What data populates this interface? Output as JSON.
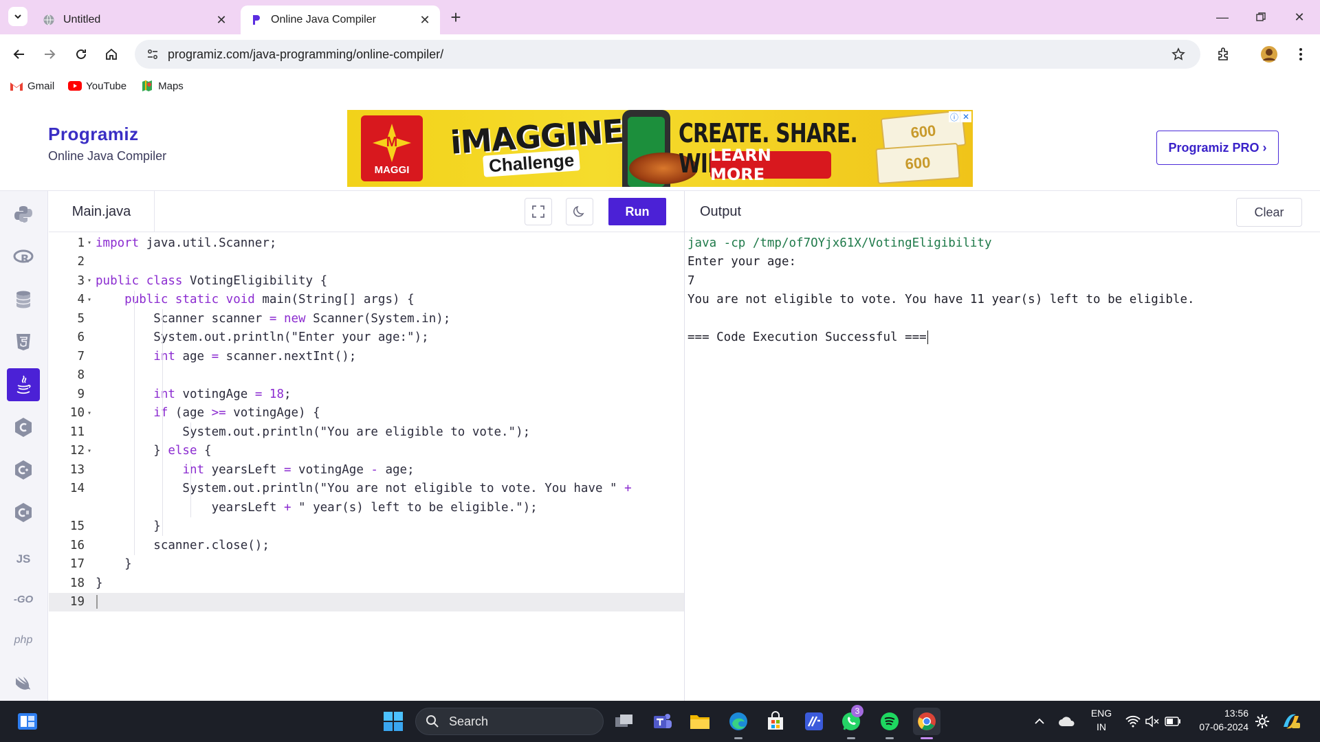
{
  "browser": {
    "tabs": [
      {
        "title": "Untitled",
        "active": false
      },
      {
        "title": "Online Java Compiler",
        "active": true
      }
    ],
    "url": "programiz.com/java-programming/online-compiler/",
    "bookmarks": [
      {
        "label": "Gmail",
        "icon": "gmail-icon"
      },
      {
        "label": "YouTube",
        "icon": "youtube-icon"
      },
      {
        "label": "Maps",
        "icon": "maps-icon"
      }
    ]
  },
  "header": {
    "logo": "Programiz",
    "subtitle": "Online Java Compiler",
    "pro_button": "Programiz PRO ›",
    "ad": {
      "brand": "MAGGI",
      "title": "iMAGGINE",
      "subtitle": "Challenge",
      "headline": "CREATE. SHARE. WIN.",
      "cta": "LEARN MORE",
      "voucher_a": "600",
      "voucher_b": "600"
    }
  },
  "sidebar": {
    "languages": [
      {
        "name": "python",
        "label": "",
        "active": false
      },
      {
        "name": "r",
        "label": "",
        "active": false
      },
      {
        "name": "sql",
        "label": "",
        "active": false
      },
      {
        "name": "html",
        "label": "",
        "active": false
      },
      {
        "name": "java",
        "label": "",
        "active": true
      },
      {
        "name": "c",
        "label": "",
        "active": false
      },
      {
        "name": "cpp",
        "label": "",
        "active": false
      },
      {
        "name": "csharp",
        "label": "",
        "active": false
      },
      {
        "name": "js",
        "label": "JS",
        "active": false
      },
      {
        "name": "go",
        "label": "-GO",
        "active": false
      },
      {
        "name": "php",
        "label": "php",
        "active": false
      },
      {
        "name": "swift",
        "label": "",
        "active": false
      }
    ]
  },
  "editor": {
    "filename": "Main.java",
    "run_label": "Run",
    "lines": [
      {
        "n": "1",
        "fold": true
      },
      {
        "n": "2",
        "fold": false
      },
      {
        "n": "3",
        "fold": true
      },
      {
        "n": "4",
        "fold": true
      },
      {
        "n": "5",
        "fold": false
      },
      {
        "n": "6",
        "fold": false
      },
      {
        "n": "7",
        "fold": false
      },
      {
        "n": "8",
        "fold": false
      },
      {
        "n": "9",
        "fold": false
      },
      {
        "n": "10",
        "fold": true
      },
      {
        "n": "11",
        "fold": false
      },
      {
        "n": "12",
        "fold": true
      },
      {
        "n": "13",
        "fold": false
      },
      {
        "n": "14",
        "fold": false
      },
      {
        "n": "",
        "fold": false
      },
      {
        "n": "15",
        "fold": false
      },
      {
        "n": "16",
        "fold": false
      },
      {
        "n": "17",
        "fold": false
      },
      {
        "n": "18",
        "fold": false
      },
      {
        "n": "19",
        "fold": false
      }
    ],
    "code": [
      [
        {
          "t": "import",
          "k": "kw"
        },
        {
          "t": " java.util.Scanner;",
          "k": ""
        }
      ],
      [],
      [
        {
          "t": "public class",
          "k": "kw"
        },
        {
          "t": " VotingEligibility {",
          "k": ""
        }
      ],
      [
        {
          "t": "    ",
          "k": ""
        },
        {
          "t": "public static void",
          "k": "kw"
        },
        {
          "t": " main(String[] args) {",
          "k": ""
        }
      ],
      [
        {
          "t": "        Scanner scanner ",
          "k": ""
        },
        {
          "t": "=",
          "k": "op"
        },
        {
          "t": " ",
          "k": ""
        },
        {
          "t": "new",
          "k": "kw"
        },
        {
          "t": " Scanner(System.in);",
          "k": ""
        }
      ],
      [
        {
          "t": "        System.out.println(\"Enter your age:\");",
          "k": ""
        }
      ],
      [
        {
          "t": "        ",
          "k": ""
        },
        {
          "t": "int",
          "k": "kw"
        },
        {
          "t": " age ",
          "k": ""
        },
        {
          "t": "=",
          "k": "op"
        },
        {
          "t": " scanner.nextInt();",
          "k": ""
        }
      ],
      [],
      [
        {
          "t": "        ",
          "k": ""
        },
        {
          "t": "int",
          "k": "kw"
        },
        {
          "t": " votingAge ",
          "k": ""
        },
        {
          "t": "=",
          "k": "op"
        },
        {
          "t": " ",
          "k": ""
        },
        {
          "t": "18",
          "k": "num"
        },
        {
          "t": ";",
          "k": ""
        }
      ],
      [
        {
          "t": "        ",
          "k": ""
        },
        {
          "t": "if",
          "k": "kw"
        },
        {
          "t": " (age ",
          "k": ""
        },
        {
          "t": ">=",
          "k": "op"
        },
        {
          "t": " votingAge) {",
          "k": ""
        }
      ],
      [
        {
          "t": "            System.out.println(\"You are eligible to vote.\");",
          "k": ""
        }
      ],
      [
        {
          "t": "        } ",
          "k": ""
        },
        {
          "t": "else",
          "k": "kw"
        },
        {
          "t": " {",
          "k": ""
        }
      ],
      [
        {
          "t": "            ",
          "k": ""
        },
        {
          "t": "int",
          "k": "kw"
        },
        {
          "t": " yearsLeft ",
          "k": ""
        },
        {
          "t": "=",
          "k": "op"
        },
        {
          "t": " votingAge ",
          "k": ""
        },
        {
          "t": "-",
          "k": "op"
        },
        {
          "t": " age;",
          "k": ""
        }
      ],
      [
        {
          "t": "            System.out.println(\"You are not eligible to vote. You have \" ",
          "k": ""
        },
        {
          "t": "+",
          "k": "op"
        }
      ],
      [
        {
          "t": "                yearsLeft ",
          "k": ""
        },
        {
          "t": "+",
          "k": "op"
        },
        {
          "t": " \" year(s) left to be eligible.\");",
          "k": ""
        }
      ],
      [
        {
          "t": "        }",
          "k": ""
        }
      ],
      [
        {
          "t": "        scanner.close();",
          "k": ""
        }
      ],
      [
        {
          "t": "    }",
          "k": ""
        }
      ],
      [
        {
          "t": "}",
          "k": ""
        }
      ],
      []
    ]
  },
  "output": {
    "title": "Output",
    "clear_label": "Clear",
    "lines": [
      {
        "text": "java -cp /tmp/of7OYjx61X/VotingEligibility",
        "cmd": true
      },
      {
        "text": "Enter your age:",
        "cmd": false
      },
      {
        "text": "7",
        "cmd": false
      },
      {
        "text": "You are not eligible to vote. You have 11 year(s) left to be eligible.",
        "cmd": false
      },
      {
        "text": "",
        "cmd": false
      },
      {
        "text": "=== Code Execution Successful ===",
        "cmd": false
      }
    ]
  },
  "taskbar": {
    "search_label": "Search",
    "whatsapp_badge": "3",
    "lang_top": "ENG",
    "lang_bottom": "IN",
    "time": "13:56",
    "date": "07-06-2024"
  },
  "colors": {
    "accent": "#4b21d6",
    "keyword": "#8b2bd0",
    "tabbar": "#f1d5f4"
  }
}
